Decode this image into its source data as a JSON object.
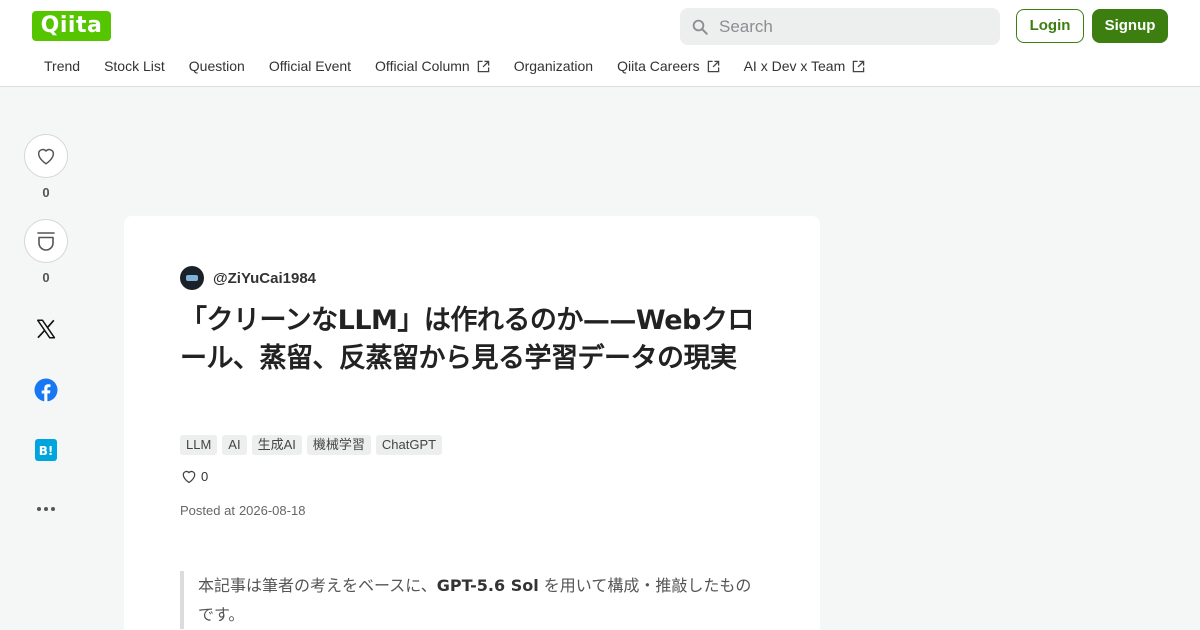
{
  "header": {
    "logo": "Qiita",
    "search_placeholder": "Search",
    "login_label": "Login",
    "signup_label": "Signup"
  },
  "nav": {
    "items": [
      {
        "label": "Trend",
        "external": false
      },
      {
        "label": "Stock List",
        "external": false
      },
      {
        "label": "Question",
        "external": false
      },
      {
        "label": "Official Event",
        "external": false
      },
      {
        "label": "Official Column",
        "external": true
      },
      {
        "label": "Organization",
        "external": false
      },
      {
        "label": "Qiita Careers",
        "external": true
      },
      {
        "label": "AI x Dev x Team",
        "external": true
      }
    ]
  },
  "sidebar": {
    "like_count": "0",
    "stock_count": "0",
    "share_icons": [
      "x-icon",
      "facebook-icon",
      "hatena-bookmark-icon",
      "more-icon"
    ]
  },
  "article": {
    "author": "@ZiYuCai1984",
    "title": "「クリーンなLLM」は作れるのか——Webクロール、蒸留、反蒸留から見る学習データの現実",
    "tags": [
      "LLM",
      "AI",
      "生成AI",
      "機械学習",
      "ChatGPT"
    ],
    "likes": "0",
    "posted_label": "Posted at",
    "posted_date": "2026-08-18",
    "quote_before": "本記事は筆者の考えをベースに、",
    "quote_bold": "GPT-5.6 Sol",
    "quote_after": " を用いて構成・推敲したものです。"
  },
  "colors": {
    "brand": "#55c500",
    "button_green": "#3c7e10",
    "page_background": "#f5f6f6"
  }
}
